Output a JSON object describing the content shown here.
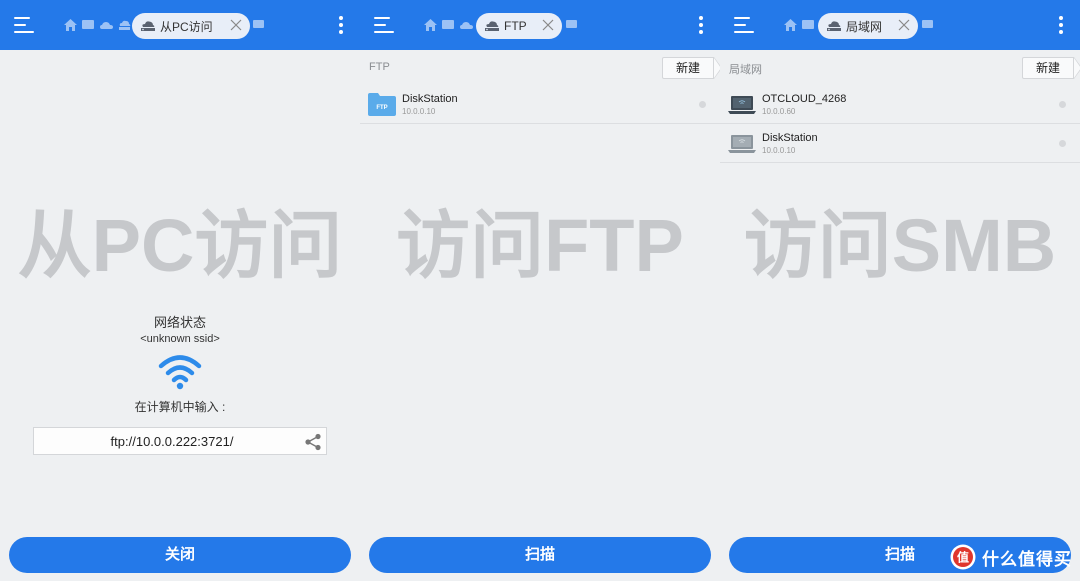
{
  "colors": {
    "accent": "#2479e9",
    "background": "#eef0f2",
    "watermark": "#c6c8cb"
  },
  "panels": [
    {
      "tab_label": "从PC访问",
      "tab_icon": "cloud-computer-icon",
      "watermark": "从PC访问",
      "network_status_label": "网络状态",
      "ssid": "<unknown ssid>",
      "enter_label": "在计算机中输入 :",
      "url": "ftp://10.0.0.222:3721/",
      "button_label": "关闭"
    },
    {
      "tab_label": "FTP",
      "tab_icon": "cloud-computer-icon",
      "section_title": "FTP",
      "new_label": "新建",
      "items": [
        {
          "name": "DiskStation",
          "address": "10.0.0.10",
          "icon": "ftp-folder-icon",
          "icon_text": "FTP"
        }
      ],
      "watermark": "访问FTP",
      "button_label": "扫描"
    },
    {
      "tab_label": "局域网",
      "tab_icon": "cloud-computer-icon",
      "section_title": "局域网",
      "new_label": "新建",
      "items": [
        {
          "name": "OTCLOUD_4268",
          "address": "10.0.0.60",
          "icon": "laptop-icon"
        },
        {
          "name": "DiskStation",
          "address": "10.0.0.10",
          "icon": "laptop-icon"
        }
      ],
      "watermark": "访问SMB",
      "button_label": "扫描"
    }
  ],
  "brand": {
    "text": "什么值得买",
    "logo": "zhi-logo-icon"
  }
}
